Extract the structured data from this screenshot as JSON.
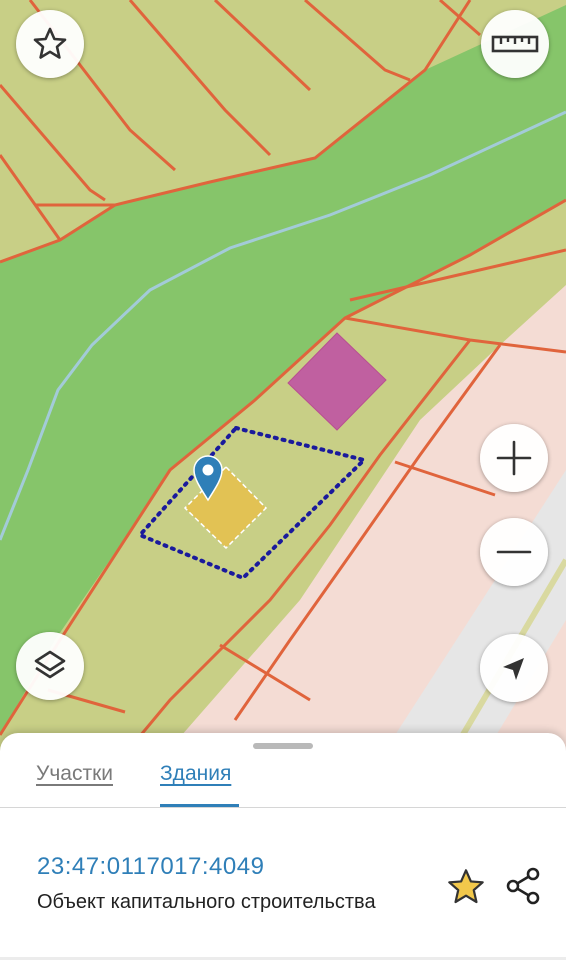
{
  "map": {
    "controls": {
      "favorite": "star-outline-icon",
      "ruler": "ruler-icon",
      "zoom_in": "plus-icon",
      "zoom_out": "minus-icon",
      "layers": "layers-icon",
      "locate": "location-arrow-icon"
    },
    "colors": {
      "forest": "#86c56a",
      "parcel_fill": "#c8cf86",
      "parcel_border": "#e0643c",
      "road_area": "#f4dcd4",
      "building_purple": "#c060a0",
      "building_selected": "#e2c254",
      "selection_outline": "#1a1a9c",
      "marker": "#2f7fb8",
      "stream": "#a3cbd8"
    }
  },
  "sheet": {
    "tabs": [
      {
        "label": "Участки",
        "active": false
      },
      {
        "label": "Здания",
        "active": true
      }
    ],
    "result": {
      "cadastral_number": "23:47:0117017:4049",
      "object_type": "Объект капитального строительства"
    },
    "actions": {
      "favorite": "star-icon",
      "share": "share-icon"
    }
  }
}
